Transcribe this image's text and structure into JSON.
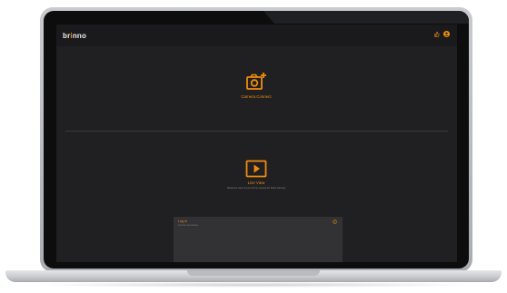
{
  "app": {
    "logo_text": "br",
    "logo_dot": "i",
    "logo_rest": "nno",
    "accent_color": "#f28c0f"
  },
  "header": {
    "icons": [
      "thumbs-up-icon",
      "user-icon"
    ]
  },
  "main": {
    "camera_connect": {
      "label": "Camera Connect",
      "icon": "camera-plus-icon"
    },
    "live_view": {
      "label": "Live View",
      "subtitle": "Real-time view of your brinno camera for better framing",
      "icon": "play-icon"
    }
  },
  "panel": {
    "title": "Log in",
    "subtitle": "Account and status",
    "icon": "info-icon"
  }
}
